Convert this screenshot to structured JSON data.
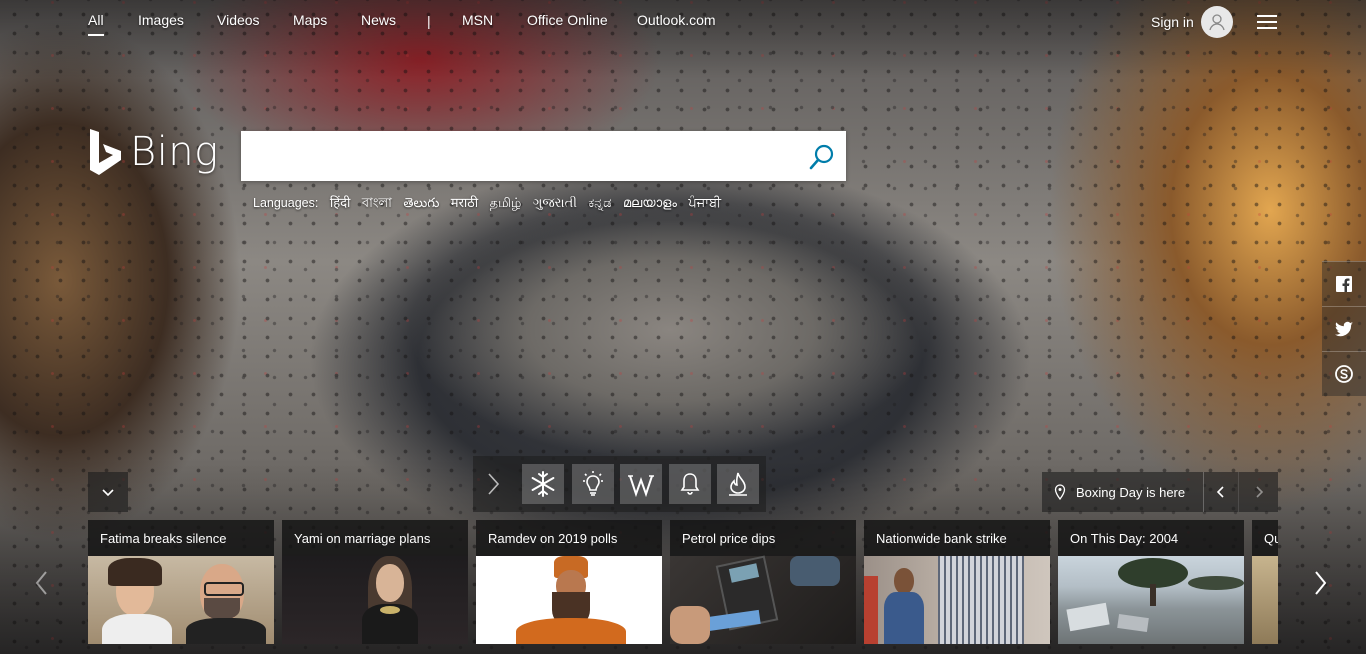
{
  "nav": {
    "links": [
      "All",
      "Images",
      "Videos",
      "Maps",
      "News",
      "MSN",
      "Office Online",
      "Outlook.com"
    ],
    "divider": "|",
    "sign_in": "Sign in"
  },
  "logo": {
    "text": "Bing"
  },
  "search": {
    "value": "",
    "placeholder": ""
  },
  "languages": {
    "label": "Languages:",
    "items": [
      "हिंदी",
      "বাংলা",
      "తెలుగు",
      "मराठी",
      "தமிழ்",
      "ગુજરાતી",
      "ಕನ್ನಡ",
      "മലയാളം",
      "ਪੰਜਾਬੀ"
    ]
  },
  "image_info": {
    "text": "Boxing Day is here"
  },
  "news": [
    {
      "title": "Fatima breaks silence"
    },
    {
      "title": "Yami on marriage plans"
    },
    {
      "title": "Ramdev on 2019 polls"
    },
    {
      "title": "Petrol price dips"
    },
    {
      "title": "Nationwide bank strike"
    },
    {
      "title": "On This Day: 2004"
    },
    {
      "title": "Qu"
    }
  ],
  "colors": {
    "accent": "#007daa",
    "overlay": "#1e1e1e"
  },
  "icons": [
    "collapse-chevron-icon",
    "snowflake-icon",
    "lightbulb-icon",
    "wikipedia-w-icon",
    "bell-icon",
    "flame-icon",
    "location-pin-icon",
    "facebook-icon",
    "twitter-icon",
    "skype-icon"
  ]
}
